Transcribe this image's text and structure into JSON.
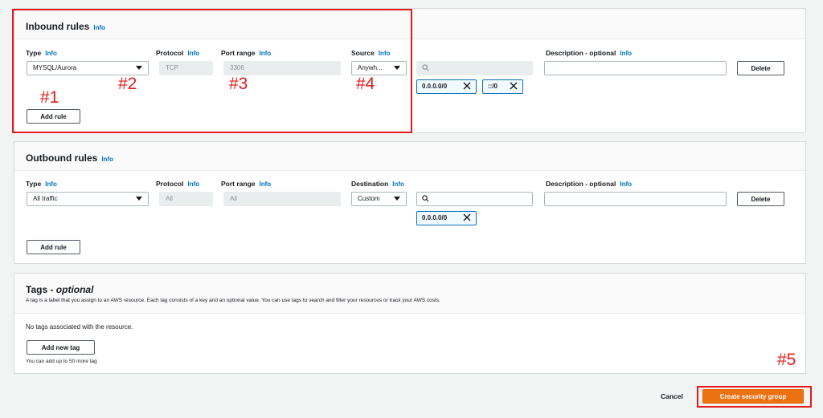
{
  "inbound": {
    "title": "Inbound rules",
    "title_info": "Info",
    "type_label": "Type",
    "protocol_label": "Protocol",
    "port_range_label": "Port range",
    "source_label": "Source",
    "description_label": "Description - optional",
    "info": "Info",
    "type_value": "MYSQL/Aurora",
    "protocol_value": "TCP",
    "port_range_value": "3306",
    "source_value": "Anywh...",
    "source_search_placeholder": "",
    "tokens": [
      "0.0.0.0/0",
      "::/0"
    ],
    "delete_label": "Delete",
    "add_rule_label": "Add rule"
  },
  "outbound": {
    "title": "Outbound rules",
    "title_info": "Info",
    "type_label": "Type",
    "protocol_label": "Protocol",
    "port_range_label": "Port range",
    "destination_label": "Destination",
    "description_label": "Description - optional",
    "info": "Info",
    "type_value": "All traffic",
    "protocol_value": "All",
    "port_range_value": "All",
    "destination_value": "Custom",
    "tokens": [
      "0.0.0.0/0"
    ],
    "delete_label": "Delete",
    "add_rule_label": "Add rule"
  },
  "tags": {
    "title_prefix": "Tags - ",
    "title_suffix": "optional",
    "description": "A tag is a label that you assign to an AWS resource. Each tag consists of a key and an optional value. You can use tags to search and filter your resources or track your AWS costs.",
    "empty_text": "No tags associated with the resource.",
    "add_tag_label": "Add new tag",
    "limit_text": "You can add up to 50 more tag"
  },
  "footer": {
    "cancel_label": "Cancel",
    "create_label": "Create security group"
  },
  "annotations": {
    "a1": "#1",
    "a2": "#2",
    "a3": "#3",
    "a4": "#4",
    "a5": "#5"
  },
  "colors": {
    "accent_orange": "#ec7211",
    "info_blue": "#0073bb",
    "annotation_red": "#e31b1b"
  }
}
